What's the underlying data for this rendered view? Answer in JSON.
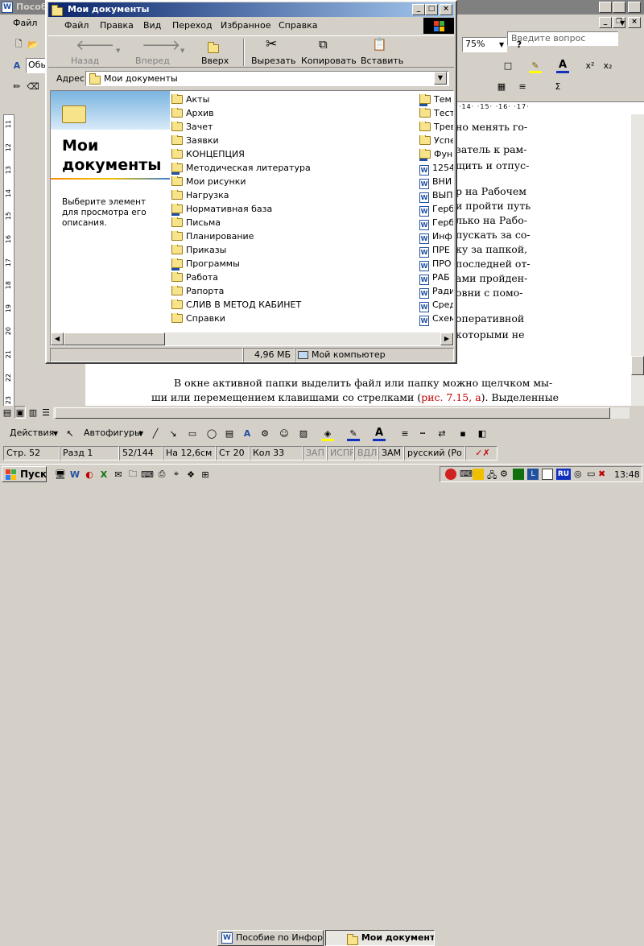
{
  "word": {
    "title": "Пособ",
    "menu_file": "Файл",
    "help_placeholder": "Введите вопрос",
    "zoom": "75%",
    "style_value": "Обы",
    "ruler_top": "·14· ·15· ·16· ·17·",
    "ruler_left": [
      "11",
      "12",
      "13",
      "14",
      "15",
      "16",
      "17",
      "18",
      "19",
      "20",
      "21",
      "22",
      "23"
    ],
    "right_lines": [
      "но менять го-",
      "затель к рам-",
      "щить и отпус-",
      "р на Рабочем",
      "и пройти путь",
      "лько на Рабо-",
      "пускать за со-",
      "ку за папкой,",
      "последней от-",
      "ами пройден-",
      "овни с помо-",
      " оперативной",
      " которыми не"
    ],
    "bottom_line1": "В окне активной папки выделить файл или папку можно щелчком мы-",
    "bottom_line2_a": "ши или перемещением клавишами со стрелками (",
    "bottom_line2_ref": "рис. 7.15, а",
    "bottom_line2_b": "). Выделенные",
    "drawing": {
      "actions": "Действия",
      "autoshapes": "Автофигуры"
    },
    "status": {
      "page": "Стр. 52",
      "section": "Разд 1",
      "pages": "52/144",
      "at": "На 12,6см",
      "line": "Ст 20",
      "col": "Кол 33",
      "rec": "ЗАП",
      "trk": "ИСПР",
      "ext": "ВДЛ",
      "ovr": "ЗАМ",
      "lang": "русский (Ро"
    }
  },
  "explorer": {
    "title": "Мои документы",
    "menu": [
      "Файл",
      "Правка",
      "Вид",
      "Переход",
      "Избранное",
      "Справка"
    ],
    "toolbar": {
      "back": "Назад",
      "forward": "Вперед",
      "up": "Вверх",
      "cut": "Вырезать",
      "copy": "Копировать",
      "paste": "Вставить"
    },
    "address_label": "Адрес",
    "address_value": "Мои документы",
    "panel_title": "Мои документы",
    "panel_desc": "Выберите элемент для просмотра его описания.",
    "col1": [
      {
        "name": "Акты",
        "type": "folder"
      },
      {
        "name": "Архив",
        "type": "folder"
      },
      {
        "name": "Зачет",
        "type": "folder"
      },
      {
        "name": "Заявки",
        "type": "folder"
      },
      {
        "name": "КОНЦЕПЦИЯ",
        "type": "folder"
      },
      {
        "name": "Методическая литература",
        "type": "shared"
      },
      {
        "name": "Мои рисунки",
        "type": "folder"
      },
      {
        "name": "Нагрузка",
        "type": "folder"
      },
      {
        "name": "Нормативная база",
        "type": "shared"
      },
      {
        "name": "Письма",
        "type": "folder"
      },
      {
        "name": "Планирование",
        "type": "folder"
      },
      {
        "name": "Приказы",
        "type": "folder"
      },
      {
        "name": "Программы",
        "type": "shared"
      },
      {
        "name": "Работа",
        "type": "folder"
      },
      {
        "name": "Рапорта",
        "type": "folder"
      },
      {
        "name": "СЛИВ В МЕТОД КАБИНЕТ",
        "type": "folder"
      },
      {
        "name": "Справки",
        "type": "folder"
      }
    ],
    "col2": [
      {
        "name": "Тем",
        "type": "shared"
      },
      {
        "name": "Тест",
        "type": "folder"
      },
      {
        "name": "Трев",
        "type": "folder"
      },
      {
        "name": "Успе",
        "type": "folder"
      },
      {
        "name": "Фун",
        "type": "shared"
      },
      {
        "name": "1254",
        "type": "doc"
      },
      {
        "name": "ВНИ",
        "type": "doc"
      },
      {
        "name": "ВЫП",
        "type": "doc"
      },
      {
        "name": "Герб",
        "type": "doc"
      },
      {
        "name": "Герб",
        "type": "doc"
      },
      {
        "name": "Инф",
        "type": "doc"
      },
      {
        "name": "ПРЕ",
        "type": "doc"
      },
      {
        "name": "ПРО",
        "type": "doc"
      },
      {
        "name": "РАБ",
        "type": "doc"
      },
      {
        "name": "Ради",
        "type": "doc"
      },
      {
        "name": "Сред",
        "type": "doc"
      },
      {
        "name": "Схем",
        "type": "doc"
      }
    ],
    "status_size": "4,96 МБ",
    "status_location": "Мой компьютер"
  },
  "taskbar": {
    "start": "Пуск",
    "task1": "Пособие по Инфор...",
    "task2": "Мои документы",
    "clock": "13:48",
    "lang": "RU"
  }
}
